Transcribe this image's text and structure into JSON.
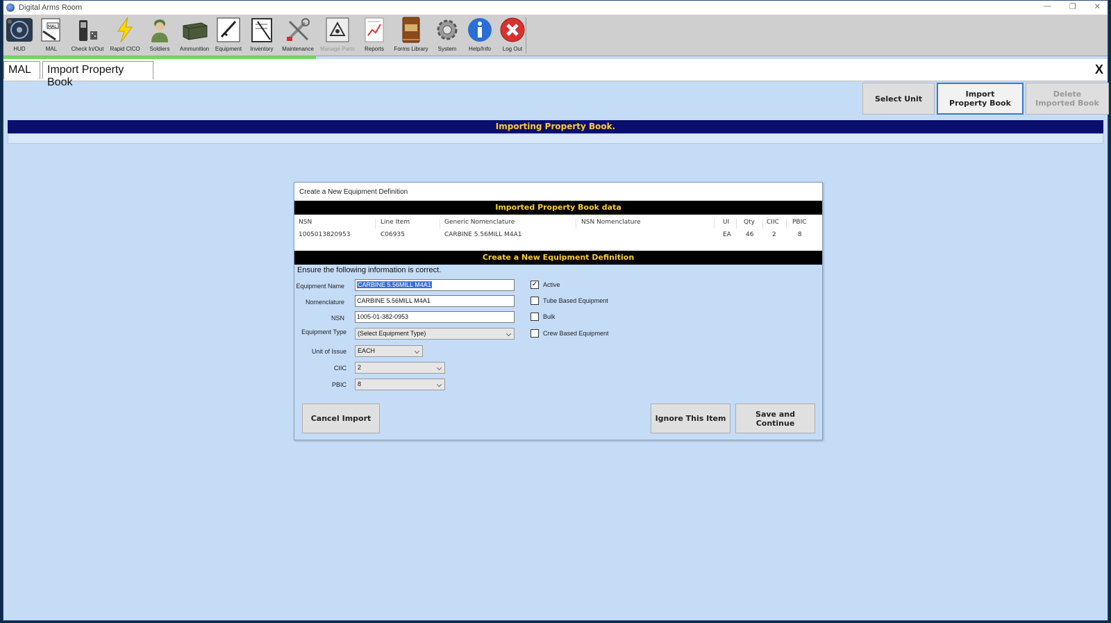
{
  "window": {
    "title": "Digital Arms Room"
  },
  "toolbar": {
    "items": [
      {
        "label": "HUD",
        "icon": "hud-icon"
      },
      {
        "label": "MAL",
        "icon": "mal-icon"
      },
      {
        "label": "Check In/Out",
        "icon": "check-in-out-icon"
      },
      {
        "label": "Rapid CICO",
        "icon": "lightning-icon"
      },
      {
        "label": "Soldiers",
        "icon": "soldier-icon"
      },
      {
        "label": "Ammunition",
        "icon": "ammo-box-icon"
      },
      {
        "label": "Equipment",
        "icon": "rifle-icon"
      },
      {
        "label": "Inventory",
        "icon": "clipboard-icon"
      },
      {
        "label": "Maintenance",
        "icon": "tools-icon"
      },
      {
        "label": "Manage Parts",
        "icon": "parts-icon",
        "disabled": true
      },
      {
        "label": "Reports",
        "icon": "report-icon"
      },
      {
        "label": "Forms Library",
        "icon": "book-icon"
      },
      {
        "label": "System",
        "icon": "gear-icon"
      },
      {
        "label": "Help/Info",
        "icon": "info-icon"
      },
      {
        "label": "Log Out",
        "icon": "logout-x-icon"
      }
    ]
  },
  "tabs": {
    "mal": "MAL",
    "import": "Import Property Book",
    "close": "X"
  },
  "actions": {
    "select_unit": "Select Unit",
    "import_property_book": "Import Property Book",
    "delete_imported_book": "Delete Imported Book"
  },
  "banner": "Importing Property Book.",
  "dialog": {
    "title": "Create a New Equipment Definition",
    "imported_header": "Imported Property Book data",
    "columns": [
      "NSN",
      "Line Item",
      "Generic Nomenclature",
      "NSN Nomenclature",
      "UI",
      "Qty",
      "CIIC",
      "PBIC"
    ],
    "row": [
      "1005013820953",
      "C06935",
      "CARBINE 5.56MILL M4A1",
      "",
      "EA",
      "46",
      "2",
      "8"
    ],
    "create_header": "Create a New Equipment Definition",
    "ensure_text": "Ensure the following information is correct.",
    "fields": {
      "equipment_name": {
        "label": "Equipment Name",
        "value": "CARBINE 5.56MILL M4A1"
      },
      "nomenclature": {
        "label": "Nomenclature",
        "value": "CARBINE 5.56MILL M4A1"
      },
      "nsn": {
        "label": "NSN",
        "value": "1005-01-382-0953"
      },
      "equipment_type": {
        "label": "Equipment Type",
        "value": "(Select Equipment Type)"
      },
      "unit_of_issue": {
        "label": "Unit of Issue",
        "value": "EACH"
      },
      "ciic": {
        "label": "CIIC",
        "value": "2"
      },
      "pbic": {
        "label": "PBIC",
        "value": "8"
      }
    },
    "checkboxes": {
      "active": {
        "label": "Active",
        "checked": true
      },
      "tube_based": {
        "label": "Tube Based Equipment",
        "checked": false
      },
      "bulk": {
        "label": "Bulk",
        "checked": false
      },
      "crew_based": {
        "label": "Crew Based Equipment",
        "checked": false
      }
    },
    "buttons": {
      "cancel": "Cancel Import",
      "ignore": "Ignore This Item",
      "save": "Save and Continue"
    }
  }
}
